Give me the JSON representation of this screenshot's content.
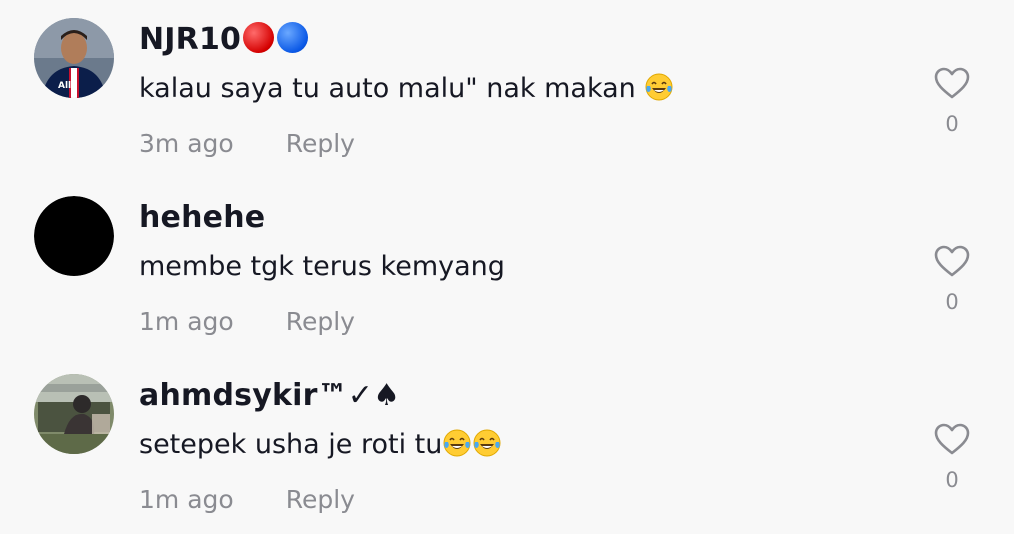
{
  "comments": [
    {
      "username": "NJR10",
      "text": "kalau saya tu auto malu\" nak makan",
      "emoji_count": 1,
      "time": "3m ago",
      "reply_label": "Reply",
      "likes": "0",
      "avatar": "player-photo-avatar",
      "username_badges": [
        "red-circle-icon",
        "blue-circle-icon"
      ]
    },
    {
      "username": "hehehe",
      "text": "membe tgk terus kemyang",
      "emoji_count": 0,
      "time": "1m ago",
      "reply_label": "Reply",
      "likes": "0",
      "avatar": "black-circle-avatar"
    },
    {
      "username": "ahmdsykir™✓♠",
      "text": "setepek usha je roti tu",
      "emoji_count": 2,
      "time": "1m ago",
      "reply_label": "Reply",
      "likes": "0",
      "avatar": "outdoor-photo-avatar"
    }
  ],
  "colors": {
    "background": "#f8f8f8",
    "text_primary": "#161823",
    "text_secondary": "#8a8b91"
  }
}
